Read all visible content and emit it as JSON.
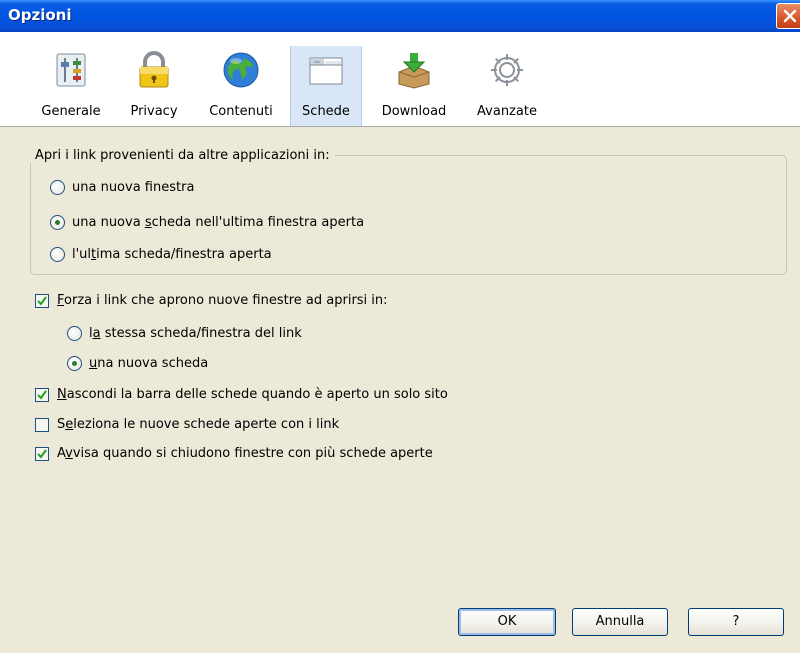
{
  "window": {
    "title": "Opzioni"
  },
  "toolbar": {
    "tabs": [
      {
        "label": "Generale",
        "icon": "sliders-icon"
      },
      {
        "label": "Privacy",
        "icon": "padlock-icon"
      },
      {
        "label": "Contenuti",
        "icon": "globe-icon"
      },
      {
        "label": "Schede",
        "icon": "tabs-window-icon",
        "selected": true
      },
      {
        "label": "Download",
        "icon": "download-box-icon"
      },
      {
        "label": "Avanzate",
        "icon": "gear-icon"
      }
    ]
  },
  "open_links": {
    "legend": "Apri i link provenienti da altre applicazioni in:",
    "options": [
      {
        "pre": "una nuova f",
        "key": "i",
        "post": "nestra",
        "selected": false
      },
      {
        "pre": "una nuova ",
        "key": "s",
        "post": "cheda nell'ultima finestra aperta",
        "selected": true
      },
      {
        "pre": "l'ul",
        "key": "t",
        "post": "ima scheda/finestra aperta",
        "selected": false
      }
    ]
  },
  "force_links": {
    "pre": "",
    "key": "F",
    "post": "orza i link che aprono nuove finestre ad aprirsi in:",
    "checked": true,
    "options": [
      {
        "pre": "l",
        "key": "a",
        "post": " stessa scheda/finestra del link",
        "selected": false
      },
      {
        "pre": "",
        "key": "u",
        "post": "na nuova scheda",
        "selected": true
      }
    ]
  },
  "checkboxes": [
    {
      "pre": "",
      "key": "N",
      "post": "ascondi la barra delle schede quando è aperto un solo sito",
      "checked": true
    },
    {
      "pre": "S",
      "key": "e",
      "post": "leziona le nuove schede aperte con i link",
      "checked": false
    },
    {
      "pre": "A",
      "key": "v",
      "post": "visa quando si chiudono finestre con più schede aperte",
      "checked": true
    }
  ],
  "buttons": {
    "ok": "OK",
    "cancel": "Annulla",
    "help": "?"
  },
  "colors": {
    "titlebar": "#0054e3",
    "dialog_bg": "#ece9d8",
    "selected_tab": "#d9e6f7"
  }
}
